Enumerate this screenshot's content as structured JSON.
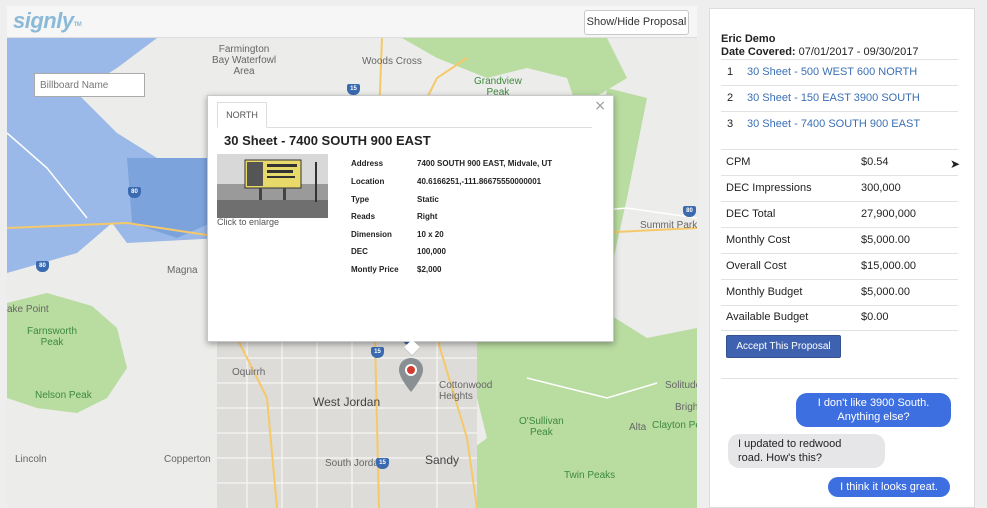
{
  "app": {
    "logo": "signly",
    "logo_tm": "TM"
  },
  "toolbar": {
    "toggle_label": "Show/Hide Proposal"
  },
  "map": {
    "search_placeholder": "Billboard Name",
    "labels": {
      "farmington": "Farmington\nBay Waterfowl\nArea",
      "woods_cross": "Woods Cross",
      "grandview": "Grandview\nPeak",
      "magna": "Magna",
      "summit_park": "Summit Park",
      "lake_point": "ake Point",
      "farnsworth": "Farnsworth\nPeak",
      "nelson": "Nelson Peak",
      "oquirrh": "Oquirrh",
      "west_jordan": "West Jordan",
      "cottonwood": "Cottonwood\nHeights",
      "solitude": "Solitude",
      "brighton": "Brighton",
      "osullivan": "O'Sullivan\nPeak",
      "alta": "Alta",
      "clayton": "Clayton Peak",
      "lincoln": "Lincoln",
      "copperton": "Copperton",
      "south_jordan": "South Jordan",
      "sandy": "Sandy",
      "twin_peaks": "Twin Peaks"
    },
    "shields": [
      "15",
      "80",
      "80",
      "80",
      "215",
      "80",
      "15",
      "15",
      "15"
    ]
  },
  "popup": {
    "tab": "NORTH",
    "title": "30 Sheet - 7400 SOUTH 900 EAST",
    "photo_caption": "Click to enlarge",
    "attributes": [
      {
        "key": "Address",
        "value": "7400 SOUTH 900 EAST, Midvale, UT"
      },
      {
        "key": "Location",
        "value": "40.6166251,-111.86675550000001"
      },
      {
        "key": "Type",
        "value": "Static"
      },
      {
        "key": "Reads",
        "value": "Right"
      },
      {
        "key": "Dimension",
        "value": "10 x 20"
      },
      {
        "key": "DEC",
        "value": "100,000"
      },
      {
        "key": "Montly Price",
        "value": "$2,000"
      }
    ]
  },
  "proposal": {
    "user": "Eric Demo",
    "date_label": "Date Covered:",
    "date_range": "07/01/2017 - 09/30/2017",
    "locations": [
      {
        "num": "1",
        "name": "30 Sheet - 500 WEST 600 NORTH"
      },
      {
        "num": "2",
        "name": "30 Sheet - 150 EAST 3900 SOUTH"
      },
      {
        "num": "3",
        "name": "30 Sheet - 7400 SOUTH 900 EAST"
      }
    ],
    "metrics": [
      {
        "key": "CPM",
        "value": "$0.54"
      },
      {
        "key": "DEC Impressions",
        "value": "300,000"
      },
      {
        "key": "DEC Total",
        "value": "27,900,000"
      },
      {
        "key": "Monthly Cost",
        "value": "$5,000.00"
      },
      {
        "key": "Overall Cost",
        "value": "$15,000.00"
      },
      {
        "key": "Monthly Budget",
        "value": "$5,000.00"
      },
      {
        "key": "Available Budget",
        "value": "$0.00"
      }
    ],
    "accept_label": "Accept This Proposal"
  },
  "chat": [
    {
      "from": "me",
      "text": "I don't like 3900 South.\nAnything else?"
    },
    {
      "from": "them",
      "text": "I updated to redwood\nroad. How's this?"
    },
    {
      "from": "me",
      "text": "I think it looks great."
    }
  ],
  "colors": {
    "accent": "#3f62b0",
    "link": "#3b6fb5",
    "bubble_out": "#3d6fe0",
    "bubble_in": "#e6e6e8",
    "water": "#9ab8e8",
    "park": "#b9dca1"
  }
}
